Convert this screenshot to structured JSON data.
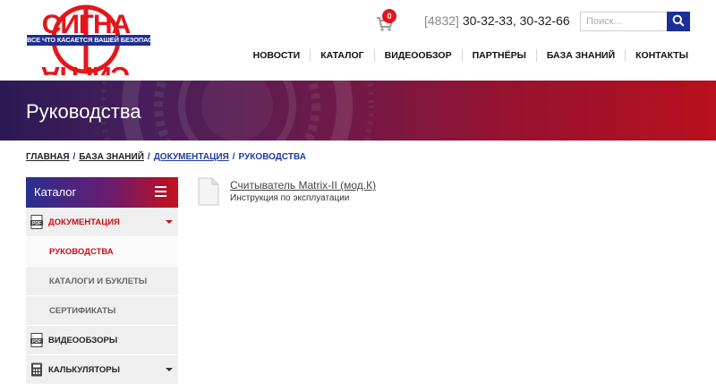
{
  "header": {
    "logo": {
      "top_word": "СИГНА",
      "bottom_word": "СИГНА",
      "tagline": "ВСЕ ЧТО КАСАЕТСЯ ВАШЕЙ БЕЗОПАСНОСТИ"
    },
    "cart": {
      "icon": "shopping-cart-icon",
      "count": "0"
    },
    "phone": {
      "code": "[4832]",
      "numbers": "30-32-33, 30-32-66"
    },
    "search": {
      "placeholder": "Поиск...",
      "value": "",
      "icon": "search-icon"
    },
    "nav": [
      {
        "label": "НОВОСТИ"
      },
      {
        "label": "КАТАЛОГ"
      },
      {
        "label": "ВИДЕООБЗОР"
      },
      {
        "label": "ПАРТНЁРЫ"
      },
      {
        "label": "БАЗА ЗНАНИЙ"
      },
      {
        "label": "КОНТАКТЫ"
      }
    ]
  },
  "banner": {
    "title": "Руководства"
  },
  "breadcrumb": {
    "items": [
      "ГЛАВНАЯ",
      "БАЗА ЗНАНИЙ",
      "ДОКУМЕНТАЦИЯ"
    ],
    "current": "РУКОВОДСТВА",
    "separator": "/"
  },
  "sidebar": {
    "title": "Каталог",
    "menu_icon": "hamburger-icon",
    "items": [
      {
        "label": "ДОКУМЕНТАЦИЯ",
        "icon": "pdf-icon",
        "expanded": true
      },
      {
        "label": "РУКОВОДСТВА",
        "sub": true,
        "active": true
      },
      {
        "label": "КАТАЛОГИ И БУКЛЕТЫ",
        "sub": true
      },
      {
        "label": "СЕРТИФИКАТЫ",
        "sub": true
      },
      {
        "label": "ВИДЕООБЗОРЫ",
        "icon": "pdf-icon"
      },
      {
        "label": "КАЛЬКУЛЯТОРЫ",
        "icon": "calculator-icon",
        "expandable": true
      }
    ]
  },
  "content": {
    "documents": [
      {
        "title": "Считыватель Matrix-II (мод.К)",
        "description": "Инструкция по эксплуатации",
        "icon": "document-icon"
      }
    ]
  },
  "colors": {
    "brand_red": "#e3161b",
    "brand_blue": "#1e2f8e",
    "active_red": "#c4101c",
    "link_blue": "#1e3aa8"
  }
}
